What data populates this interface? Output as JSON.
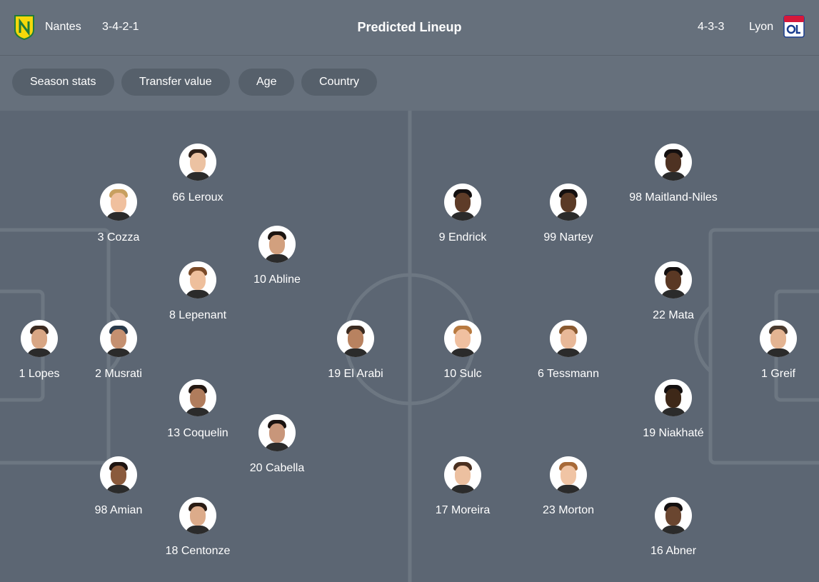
{
  "header": {
    "title": "Predicted Lineup",
    "home": {
      "name": "Nantes",
      "formation": "3-4-2-1",
      "crest_icon": "nantes-crest-icon",
      "crest_color": "#f5d90a"
    },
    "away": {
      "name": "Lyon",
      "formation": "4-3-3",
      "crest_icon": "lyon-crest-icon",
      "crest_color": "#1a3d8f"
    }
  },
  "filters": [
    "Season stats",
    "Transfer value",
    "Age",
    "Country"
  ],
  "colors": {
    "background": "#5c6673",
    "header": "#66707c",
    "chip": "#56606b",
    "pitch_lines": "#6d7782"
  },
  "players": {
    "home": [
      {
        "number": "1",
        "name": "Lopes",
        "label": "1 Lopes"
      },
      {
        "number": "2",
        "name": "Musrati",
        "label": "2 Musrati"
      },
      {
        "number": "3",
        "name": "Cozza",
        "label": "3 Cozza"
      },
      {
        "number": "98",
        "name": "Amian",
        "label": "98 Amian"
      },
      {
        "number": "66",
        "name": "Leroux",
        "label": "66 Leroux"
      },
      {
        "number": "8",
        "name": "Lepenant",
        "label": "8 Lepenant"
      },
      {
        "number": "13",
        "name": "Coquelin",
        "label": "13 Coquelin"
      },
      {
        "number": "18",
        "name": "Centonze",
        "label": "18 Centonze"
      },
      {
        "number": "10",
        "name": "Abline",
        "label": "10 Abline"
      },
      {
        "number": "20",
        "name": "Cabella",
        "label": "20 Cabella"
      },
      {
        "number": "19",
        "name": "El Arabi",
        "label": "19 El Arabi"
      }
    ],
    "away": [
      {
        "number": "9",
        "name": "Endrick",
        "label": "9 Endrick"
      },
      {
        "number": "10",
        "name": "Sulc",
        "label": "10 Sulc"
      },
      {
        "number": "17",
        "name": "Moreira",
        "label": "17 Moreira"
      },
      {
        "number": "99",
        "name": "Nartey",
        "label": "99 Nartey"
      },
      {
        "number": "6",
        "name": "Tessmann",
        "label": "6 Tessmann"
      },
      {
        "number": "23",
        "name": "Morton",
        "label": "23 Morton"
      },
      {
        "number": "98",
        "name": "Maitland-Niles",
        "label": "98 Maitland-Niles"
      },
      {
        "number": "22",
        "name": "Mata",
        "label": "22 Mata"
      },
      {
        "number": "19",
        "name": "Niakhaté",
        "label": "19 Niakhaté"
      },
      {
        "number": "16",
        "name": "Abner",
        "label": "16 Abner"
      },
      {
        "number": "1",
        "name": "Greif",
        "label": "1 Greif"
      }
    ]
  }
}
